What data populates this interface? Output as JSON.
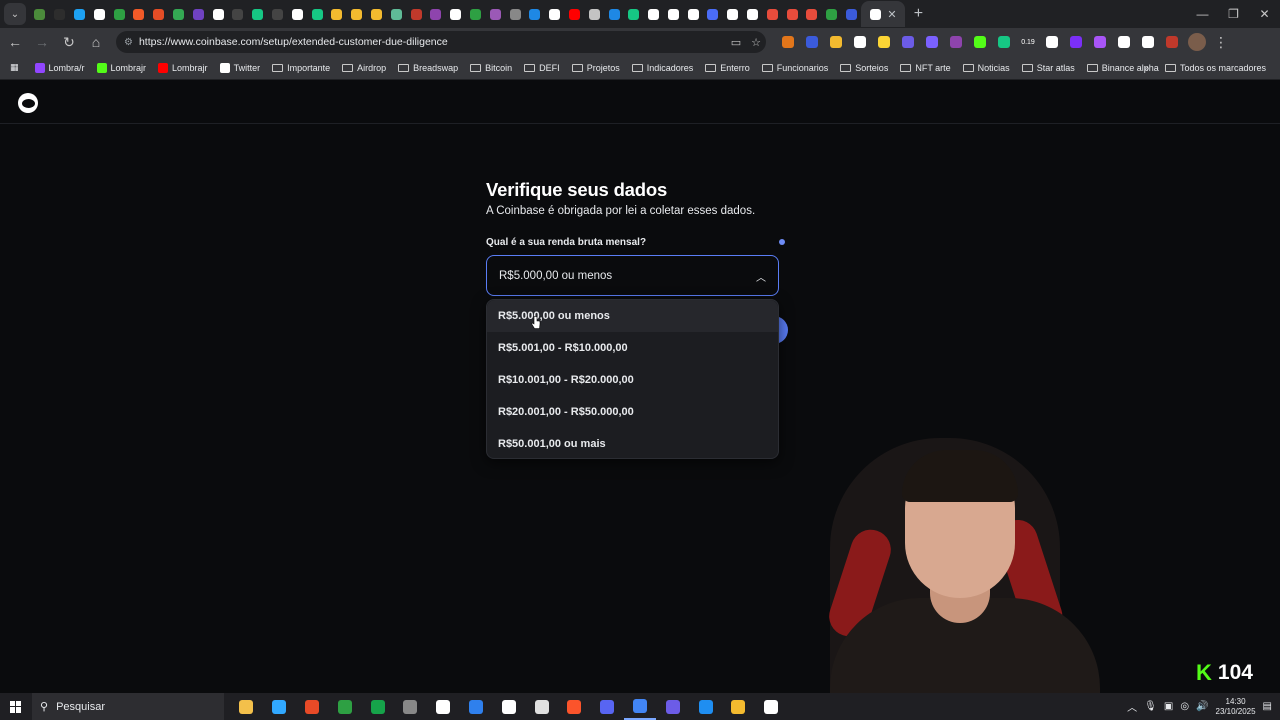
{
  "browser": {
    "url": "https://www.coinbase.com/setup/extended-customer-due-diligence",
    "tabs_favicon_colors": [
      "#4b8b3b",
      "#2d2d2d",
      "#1da1f2",
      "#ffffff",
      "#2ea043",
      "#f05a28",
      "#e44d26",
      "#34a853",
      "#6f42c1",
      "#ffffff",
      "#444",
      "#16c784",
      "#444",
      "#ffffff",
      "#16c784",
      "#f3ba2f",
      "#f3ba2f",
      "#f3ba2f",
      "#5fbb97",
      "#c0392b",
      "#8e44ad",
      "#ffffff",
      "#2ea043",
      "#9b59b6",
      "#888",
      "#1e88e5",
      "#ffffff",
      "#ff0000",
      "#c3c3c3",
      "#1e88e5",
      "#16c784",
      "#ffffff",
      "#ffffff",
      "#ffffff",
      "#4a6cf7",
      "#ffffff",
      "#ffffff",
      "#e74c3c",
      "#e74c3c",
      "#e74c3c",
      "#2ea043",
      "#3b5bdb",
      "#ffffff"
    ],
    "active_tab_close": "✕",
    "new_tab": "+",
    "bookmarks": [
      {
        "label": "Lombra/r",
        "icon_color": "#9146ff",
        "type": "site"
      },
      {
        "label": "Lombrajr",
        "icon_color": "#53fc18",
        "type": "site"
      },
      {
        "label": "Lombrajr",
        "icon_color": "#ff0000",
        "type": "site"
      },
      {
        "label": "Twitter",
        "icon_color": "#ffffff",
        "type": "site"
      },
      {
        "label": "Importante",
        "type": "folder"
      },
      {
        "label": "Airdrop",
        "type": "folder"
      },
      {
        "label": "Breadswap",
        "type": "folder"
      },
      {
        "label": "Bitcoin",
        "type": "folder"
      },
      {
        "label": "DEFI",
        "type": "folder"
      },
      {
        "label": "Projetos",
        "type": "folder"
      },
      {
        "label": "Indicadores",
        "type": "folder"
      },
      {
        "label": "Enterro",
        "type": "folder"
      },
      {
        "label": "Funcionarios",
        "type": "folder"
      },
      {
        "label": "Sorteios",
        "type": "folder"
      },
      {
        "label": "NFT arte",
        "type": "folder"
      },
      {
        "label": "Noticias",
        "type": "folder"
      },
      {
        "label": "Star atlas",
        "type": "folder"
      },
      {
        "label": "Binance alpha",
        "type": "folder"
      }
    ],
    "bookmarks_overflow": "»",
    "all_bookmarks": "Todos os marcadores",
    "extension_colors": [
      "#e2761b",
      "#3b5bdb",
      "#f3ba2f",
      "#ffffff",
      "#fcd535",
      "#6c5ce7",
      "#7b61ff",
      "#8e44ad",
      "#53fc18",
      "#16c784",
      "#ffffff",
      "#ffffff",
      "#7b2ff7",
      "#a855f7",
      "#ffffff",
      "#ffffff",
      "#c0392b"
    ],
    "ext_badge": "0.19"
  },
  "page": {
    "title": "Verifique seus dados",
    "subtitle": "A Coinbase é obrigada por lei a coletar esses dados.",
    "question": "Qual é a sua renda bruta mensal?",
    "selected_value": "R$5.000,00 ou menos",
    "options": [
      "R$5.000,00 ou menos",
      "R$5.001,00 - R$10.000,00",
      "R$10.001,00 - R$20.000,00",
      "R$20.001,00 - R$50.000,00",
      "R$50.001,00 ou mais"
    ],
    "accent": "#5a7df5"
  },
  "overlay": {
    "viewer_count": "104",
    "kick_brand_color": "#53fc18"
  },
  "taskbar": {
    "search_placeholder": "Pesquisar",
    "time": "14:30",
    "date": "23/10/2025",
    "app_colors": [
      "#f3c04b",
      "#31a8ff",
      "#e84a27",
      "#2ea043",
      "#16a34a",
      "#888",
      "#ffffff",
      "#2f80ed",
      "#ffffff",
      "#e0e0e0",
      "#fb542b",
      "#5865f2",
      "#4285f4",
      "#6c5ce7",
      "#1f8ef1",
      "#f3ba2f",
      "#ffffff"
    ]
  }
}
